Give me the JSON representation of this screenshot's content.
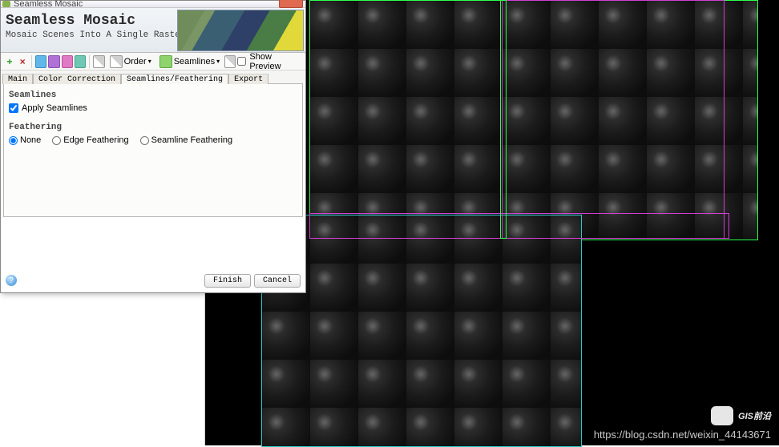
{
  "titlebar": {
    "title": "Seamless Mosaic"
  },
  "banner": {
    "title": "Seamless Mosaic",
    "subtitle": "Mosaic Scenes Into A Single Raster"
  },
  "toolbar": {
    "order_label": "Order",
    "seamlines_label": "Seamlines",
    "show_preview_label": "Show Preview",
    "icons": {
      "add": "add-icon",
      "remove": "remove-icon",
      "sel1": "select-all-icon",
      "sel2": "select-inverse-icon",
      "sel3": "select-union-icon",
      "sel4": "select-intersect-icon",
      "copy": "copy-icon",
      "order": "order-icon",
      "seam": "seamlines-icon",
      "tool": "misc-tool-icon"
    }
  },
  "tabs": {
    "main": "Main",
    "color": "Color Correction",
    "seam": "Seamlines/Feathering",
    "export": "Export"
  },
  "panel": {
    "seamlines_group": "Seamlines",
    "apply_seamlines": "Apply Seamlines",
    "apply_seamlines_checked": true,
    "feathering_group": "Feathering",
    "radio_none": "None",
    "radio_edge": "Edge Feathering",
    "radio_seam": "Seamline Feathering",
    "radio_selected": "None"
  },
  "footer": {
    "finish": "Finish",
    "cancel": "Cancel",
    "help": "?"
  },
  "watermark": {
    "main": "GIS前沿",
    "url": "https://blog.csdn.net/weixin_44143671"
  }
}
